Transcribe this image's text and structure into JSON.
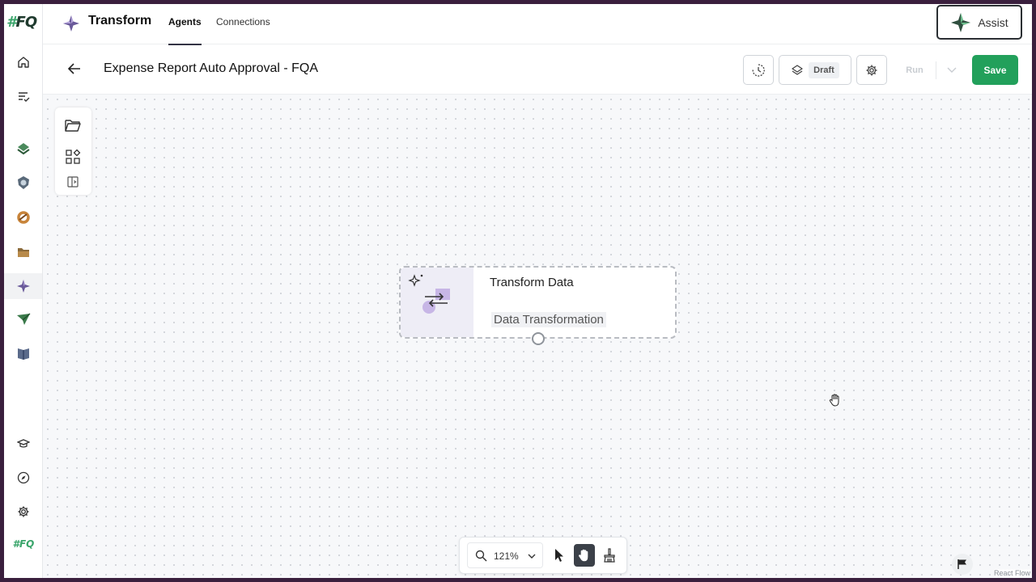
{
  "rail": {
    "logo_hash": "#",
    "logo_text": "FQ",
    "bottom_logo": "#FQ"
  },
  "topnav": {
    "app_title": "Transform",
    "tabs": [
      {
        "label": "Agents",
        "active": true
      },
      {
        "label": "Connections",
        "active": false
      }
    ],
    "assist_label": "Assist"
  },
  "header": {
    "title": "Expense Report Auto Approval - FQA",
    "draft_label": "Draft",
    "run_label": "Run",
    "save_label": "Save"
  },
  "node": {
    "title": "Transform Data",
    "subtitle": "Data Transformation"
  },
  "toolbar": {
    "zoom": "121%"
  },
  "attribution": "React Flow",
  "colors": {
    "accent_green": "#22a05b",
    "brand_purple": "#7a5fa8",
    "frame_border": "#3a1f3d"
  }
}
